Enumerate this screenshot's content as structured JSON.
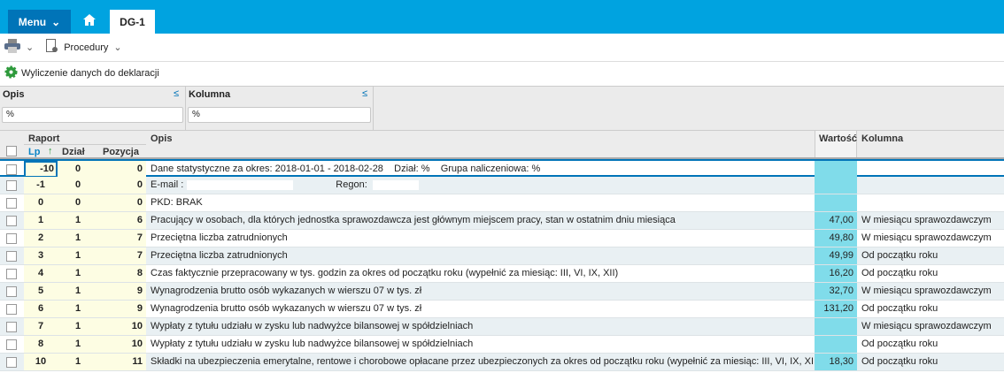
{
  "topbar": {
    "menu": "Menu",
    "tab": "DG-1"
  },
  "toolbar": {
    "procedures": "Procedury"
  },
  "title": "Wyliczenie danych do deklaracji",
  "filters": [
    {
      "label": "Opis",
      "value": "%"
    },
    {
      "label": "Kolumna",
      "value": "%"
    }
  ],
  "colors": {
    "accent": "#00a3e0",
    "dark": "#0074b8",
    "value_cell": "#80dcea"
  },
  "grid": {
    "headers": {
      "group": "Raport",
      "lp": "Lp",
      "dzial": "Dział",
      "pozycja": "Pozycja",
      "opis": "Opis",
      "wartosc": "Wartość",
      "kolumna": "Kolumna"
    },
    "rows": [
      {
        "lp": "-10",
        "dzial": "0",
        "pozycja": "0",
        "opis": "Dane statystyczne za okres: 2018-01-01 - 2018-02-28    Dział: %    Grupa naliczeniowa: %",
        "wartosc": "",
        "kolumna": ""
      },
      {
        "lp": "-1",
        "dzial": "0",
        "pozycja": "0",
        "opis": "E-mail :",
        "opis2": "Regon:",
        "wartosc": "",
        "kolumna": ""
      },
      {
        "lp": "0",
        "dzial": "0",
        "pozycja": "0",
        "opis": "PKD: BRAK",
        "wartosc": "",
        "kolumna": ""
      },
      {
        "lp": "1",
        "dzial": "1",
        "pozycja": "6",
        "opis": "Pracujący w osobach, dla których jednostka sprawozdawcza jest głównym miejscem pracy, stan w ostatnim dniu miesiąca",
        "wartosc": "47,00",
        "kolumna": "W miesiącu sprawozdawczym"
      },
      {
        "lp": "2",
        "dzial": "1",
        "pozycja": "7",
        "opis": "Przeciętna liczba zatrudnionych",
        "wartosc": "49,80",
        "kolumna": "W miesiącu sprawozdawczym"
      },
      {
        "lp": "3",
        "dzial": "1",
        "pozycja": "7",
        "opis": "Przeciętna liczba zatrudnionych",
        "wartosc": "49,99",
        "kolumna": "Od początku roku"
      },
      {
        "lp": "4",
        "dzial": "1",
        "pozycja": "8",
        "opis": "Czas faktycznie przepracowany w tys. godzin za okres od początku roku (wypełnić za miesiąc: III, VI, IX, XII)",
        "wartosc": "16,20",
        "kolumna": "Od początku roku"
      },
      {
        "lp": "5",
        "dzial": "1",
        "pozycja": "9",
        "opis": "Wynagrodzenia brutto osób wykazanych w wierszu 07 w tys. zł",
        "wartosc": "32,70",
        "kolumna": "W miesiącu sprawozdawczym"
      },
      {
        "lp": "6",
        "dzial": "1",
        "pozycja": "9",
        "opis": "Wynagrodzenia brutto osób wykazanych w wierszu 07 w tys. zł",
        "wartosc": "131,20",
        "kolumna": "Od początku roku"
      },
      {
        "lp": "7",
        "dzial": "1",
        "pozycja": "10",
        "opis": "Wypłaty z tytułu udziału w zysku lub nadwyżce bilansowej w spółdzielniach",
        "wartosc": "",
        "kolumna": "W miesiącu sprawozdawczym"
      },
      {
        "lp": "8",
        "dzial": "1",
        "pozycja": "10",
        "opis": "Wypłaty z tytułu udziału w zysku lub nadwyżce bilansowej w spółdzielniach",
        "wartosc": "",
        "kolumna": "Od początku roku"
      },
      {
        "lp": "10",
        "dzial": "1",
        "pozycja": "11",
        "opis": "Składki na ubezpieczenia emerytalne, rentowe i chorobowe opłacane przez ubezpieczonych za okres od początku roku (wypełnić za miesiąc: III, VI, IX, XII)",
        "wartosc": "18,30",
        "kolumna": "Od początku roku"
      }
    ]
  }
}
